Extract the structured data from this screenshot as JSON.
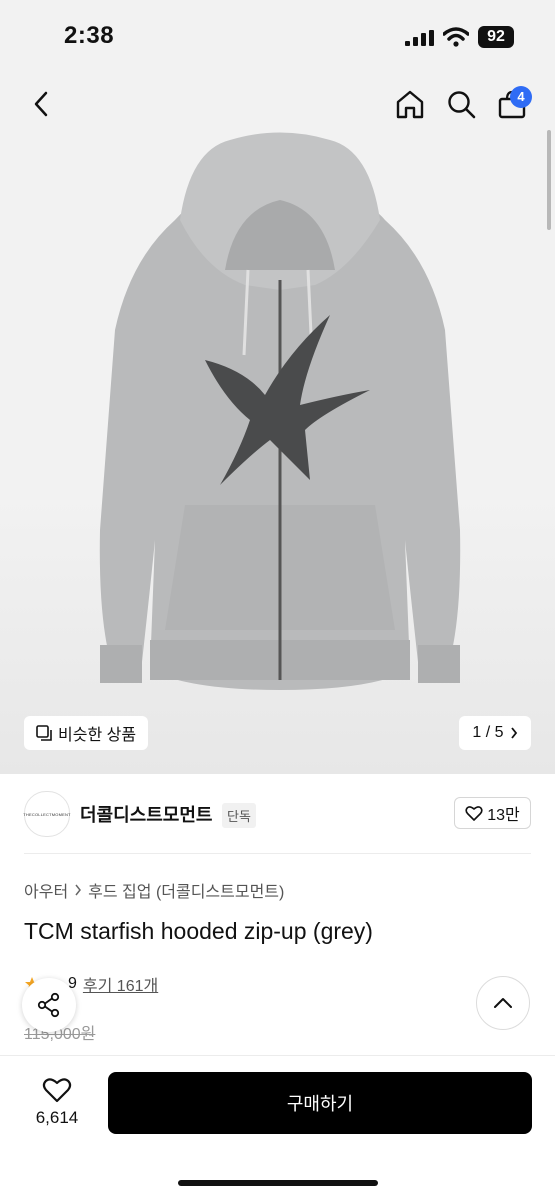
{
  "status_bar": {
    "time": "2:38",
    "battery": "92"
  },
  "header": {
    "cart_count": "4"
  },
  "gallery": {
    "similar_label": "비슷한 상품",
    "pager": "1 / 5"
  },
  "brand": {
    "logo_text": "THECOLLECTMOMENT",
    "name": "더콜디스트모먼트",
    "badge": "단독",
    "likes": "13만"
  },
  "product": {
    "breadcrumb": [
      "아우터",
      "후드 집업 (더콜디스트모먼트)"
    ],
    "title": "TCM starfish hooded zip-up (grey)",
    "rating_partial": "9",
    "reviews": "후기 161개",
    "original_price": "115,000원"
  },
  "bottom": {
    "wish_count": "6,614",
    "buy_label": "구매하기"
  },
  "colors": {
    "accent_badge": "#2f6cf5",
    "buy_button": "#000000"
  },
  "icons": [
    "back-icon",
    "home-icon",
    "search-icon",
    "cart-icon",
    "similar-icon",
    "chevron-right-icon",
    "heart-icon",
    "share-icon",
    "chevron-up-icon",
    "star-icon"
  ]
}
